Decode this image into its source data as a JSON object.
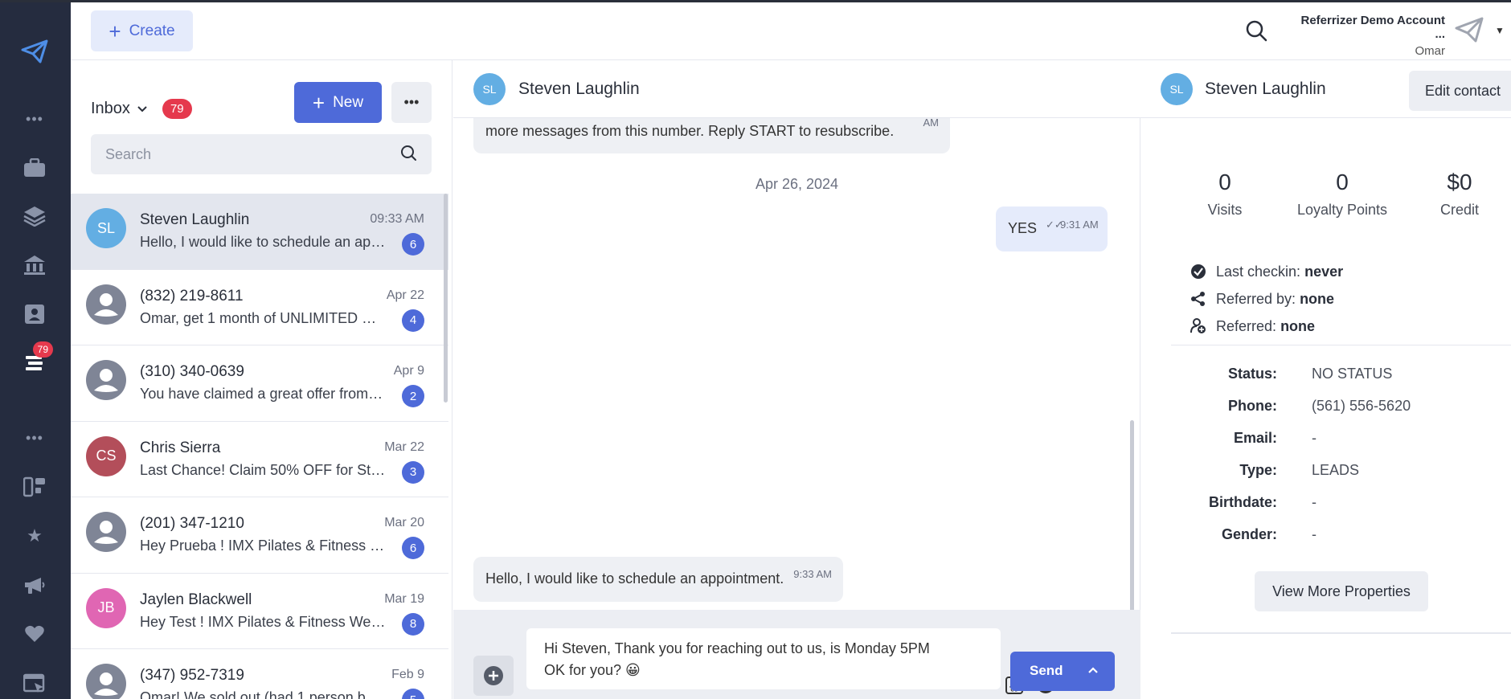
{
  "colors": {
    "primary": "#4e6ad9",
    "badge_red": "#e5394d",
    "rail_bg": "#252c3f"
  },
  "rail": {
    "inbox_badge": "79"
  },
  "topbar": {
    "create_label": "Create",
    "account_name": "Referrizer Demo Account ...",
    "account_user": "Omar"
  },
  "inbox": {
    "title": "Inbox",
    "count": "79",
    "new_label": "New",
    "search_placeholder": "Search",
    "conversations": [
      {
        "initials": "SL",
        "color": "#63aee3",
        "name": "Steven Laughlin",
        "date": "09:33 AM",
        "preview": "Hello, I would like to schedule an appo...",
        "count": "6",
        "active": true
      },
      {
        "initials": "",
        "color": "#7f8596",
        "name": "(832) 219-8611",
        "date": "Apr 22",
        "preview": "Omar, get 1 month of UNLIMITED Cor...",
        "count": "4"
      },
      {
        "initials": "",
        "color": "#7f8596",
        "name": "(310) 340-0639",
        "date": "Apr 9",
        "preview": "You have claimed a great offer from L...",
        "count": "2"
      },
      {
        "initials": "CS",
        "color": "#b34e5a",
        "name": "Chris Sierra",
        "date": "Mar 22",
        "preview": "Last Chance! Claim 50% OFF for St. P...",
        "count": "3"
      },
      {
        "initials": "",
        "color": "#7f8596",
        "name": "(201) 347-1210",
        "date": "Mar 20",
        "preview": "Hey Prueba ! IMX Pilates & Fitness Wy...",
        "count": "6"
      },
      {
        "initials": "JB",
        "color": "#e066b3",
        "name": "Jaylen Blackwell",
        "date": "Mar 19",
        "preview": "Hey Test ! IMX Pilates & Fitness West...",
        "count": "8"
      },
      {
        "initials": "",
        "color": "#7f8596",
        "name": "(347) 952-7319",
        "date": "Feb 9",
        "preview": "Omar! We sold out (had 1 person back...",
        "count": "5"
      }
    ]
  },
  "chat": {
    "contact_initials": "SL",
    "contact_name": "Steven Laughlin",
    "avatar_color": "#63aee3",
    "msg1_text": "more messages from this number. Reply START to resubscribe.",
    "msg1_time": "AM",
    "date_separator": "Apr 26, 2024",
    "msg2_text": "YES",
    "msg2_time": "9:31 AM",
    "msg3_text": "Hello, I would like to schedule an appointment.",
    "msg3_time": "9:33 AM",
    "composer_line1": "Hi Steven, Thank you for reaching out to us, is Monday 5PM",
    "composer_line2": "OK for you? 😀",
    "send_label": "Send"
  },
  "contact": {
    "initials": "SL",
    "name": "Steven Laughlin",
    "edit_label": "Edit contact",
    "stats": [
      {
        "num": "0",
        "label": "Visits"
      },
      {
        "num": "0",
        "label": "Loyalty Points"
      },
      {
        "num": "$0",
        "label": "Credit"
      }
    ],
    "last_checkin_label": "Last checkin:",
    "last_checkin_value": "never",
    "referred_by_label": "Referred by:",
    "referred_by_value": "none",
    "referred_label": "Referred:",
    "referred_value": "none",
    "properties": [
      {
        "key": "Status:",
        "value": "NO STATUS"
      },
      {
        "key": "Phone:",
        "value": "(561) 556-5620"
      },
      {
        "key": "Email:",
        "value": "-"
      },
      {
        "key": "Type:",
        "value": "LEADS"
      },
      {
        "key": "Birthdate:",
        "value": "-"
      },
      {
        "key": "Gender:",
        "value": "-"
      }
    ],
    "view_more_label": "View More Properties"
  }
}
